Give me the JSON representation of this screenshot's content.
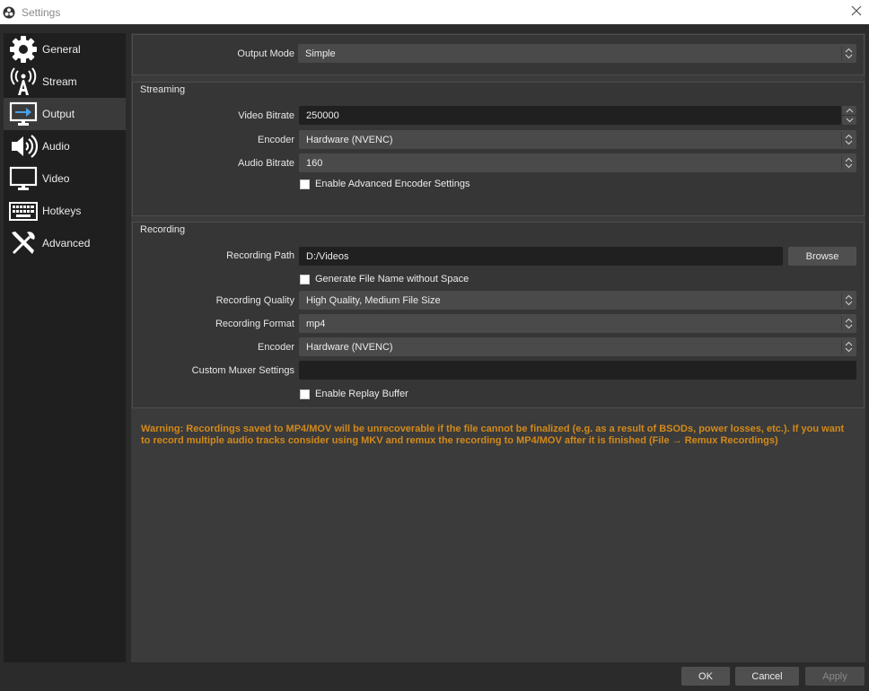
{
  "window": {
    "title": "Settings"
  },
  "sidebar": {
    "items": [
      {
        "label": "General",
        "icon": "gear-icon"
      },
      {
        "label": "Stream",
        "icon": "broadcast-icon"
      },
      {
        "label": "Output",
        "icon": "output-monitor-icon"
      },
      {
        "label": "Audio",
        "icon": "speaker-icon"
      },
      {
        "label": "Video",
        "icon": "monitor-icon"
      },
      {
        "label": "Hotkeys",
        "icon": "keyboard-icon"
      },
      {
        "label": "Advanced",
        "icon": "tools-icon"
      }
    ],
    "active": "Output"
  },
  "output_mode": {
    "label": "Output Mode",
    "value": "Simple"
  },
  "streaming": {
    "title": "Streaming",
    "video_bitrate_label": "Video Bitrate",
    "video_bitrate_value": "250000",
    "encoder_label": "Encoder",
    "encoder_value": "Hardware (NVENC)",
    "audio_bitrate_label": "Audio Bitrate",
    "audio_bitrate_value": "160",
    "advanced_encoder_label": "Enable Advanced Encoder Settings",
    "advanced_encoder_checked": false
  },
  "recording": {
    "title": "Recording",
    "path_label": "Recording Path",
    "path_value": "D:/Videos",
    "browse_label": "Browse",
    "filename_nospace_label": "Generate File Name without Space",
    "filename_nospace_checked": false,
    "quality_label": "Recording Quality",
    "quality_value": "High Quality, Medium File Size",
    "format_label": "Recording Format",
    "format_value": "mp4",
    "encoder_label": "Encoder",
    "encoder_value": "Hardware (NVENC)",
    "muxer_label": "Custom Muxer Settings",
    "muxer_value": "",
    "replay_label": "Enable Replay Buffer",
    "replay_checked": false
  },
  "warning": {
    "text": "Warning: Recordings saved to MP4/MOV will be unrecoverable if the file cannot be finalized (e.g. as a result of BSODs, power losses, etc.). If you want to record multiple audio tracks consider using MKV and remux the recording to MP4/MOV after it is finished (File → Remux Recordings)"
  },
  "footer": {
    "ok_label": "OK",
    "cancel_label": "Cancel",
    "apply_label": "Apply"
  },
  "colors": {
    "background": "#2b2b2b",
    "sidebar": "#1f1f1f",
    "panel": "#363636",
    "warning_text": "#d2891a",
    "active_item": "#3a3a3a"
  }
}
